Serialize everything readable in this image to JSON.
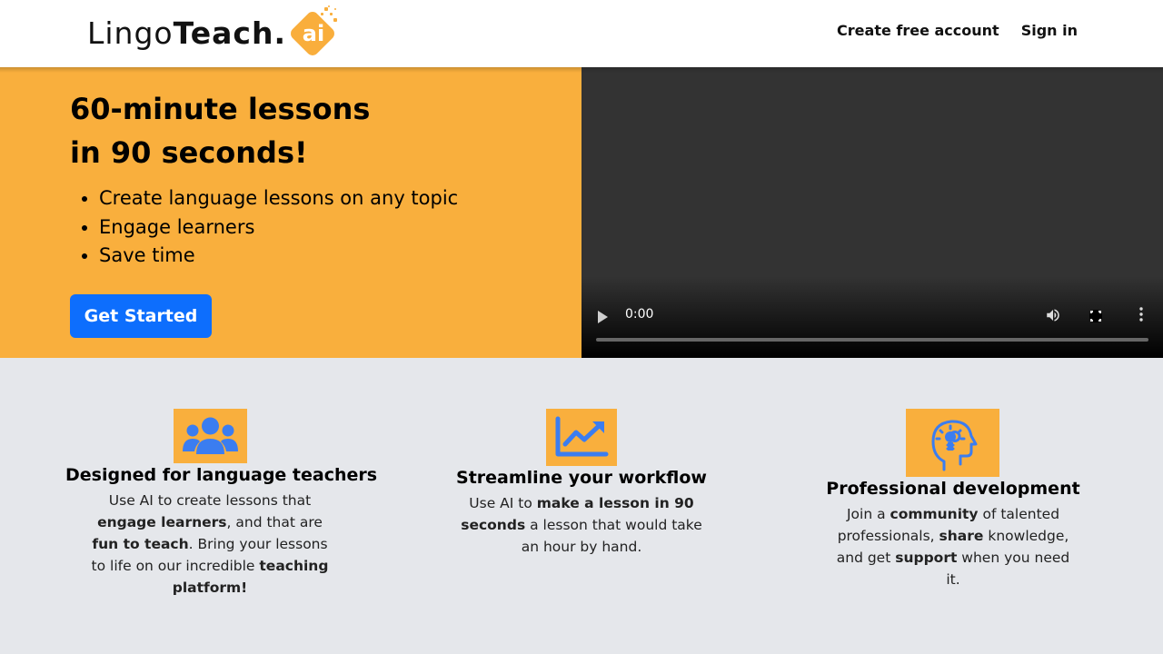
{
  "brand": {
    "name_light": "Lingo",
    "name_bold": "Teach",
    "dot": ".",
    "badge": "ai"
  },
  "nav": {
    "create_account": "Create free account",
    "sign_in": "Sign in"
  },
  "hero": {
    "title_line1": "60-minute lessons",
    "title_line2": "in 90 seconds!",
    "bullets": [
      "Create language lessons on any topic",
      "Engage learners",
      "Save time"
    ],
    "cta": "Get Started"
  },
  "video": {
    "time": "0:00",
    "controls": [
      "play-icon",
      "volume-icon",
      "fullscreen-icon",
      "more-options-icon"
    ]
  },
  "features": [
    {
      "icon": "users-group-icon",
      "title": "Designed for language teachers",
      "text": [
        {
          "t": "Use AI to create lessons that ",
          "b": false
        },
        {
          "t": "engage learners",
          "b": true
        },
        {
          "t": ", and that are ",
          "b": false
        },
        {
          "t": "fun to teach",
          "b": true
        },
        {
          "t": ". Bring your lessons to life on our incredible ",
          "b": false
        },
        {
          "t": "teaching platform!",
          "b": true
        }
      ]
    },
    {
      "icon": "chart-trending-up-icon",
      "title": "Streamline your workflow",
      "text": [
        {
          "t": "Use AI to ",
          "b": false
        },
        {
          "t": "make a lesson in 90 seconds",
          "b": true
        },
        {
          "t": " a lesson that would take an hour by hand.",
          "b": false
        }
      ]
    },
    {
      "icon": "head-lightbulb-icon",
      "title": "Professional development",
      "text": [
        {
          "t": "Join a ",
          "b": false
        },
        {
          "t": "community",
          "b": true
        },
        {
          "t": " of talented professionals, ",
          "b": false
        },
        {
          "t": "share",
          "b": true
        },
        {
          "t": " knowledge, and get ",
          "b": false
        },
        {
          "t": "support",
          "b": true
        },
        {
          "t": " when you need it.",
          "b": false
        }
      ]
    }
  ],
  "colors": {
    "hero_bg": "#f9af3d",
    "cta_bg": "#0d6efd",
    "icon_blue": "#3b7df0",
    "section_bg": "#e5e7eb"
  }
}
